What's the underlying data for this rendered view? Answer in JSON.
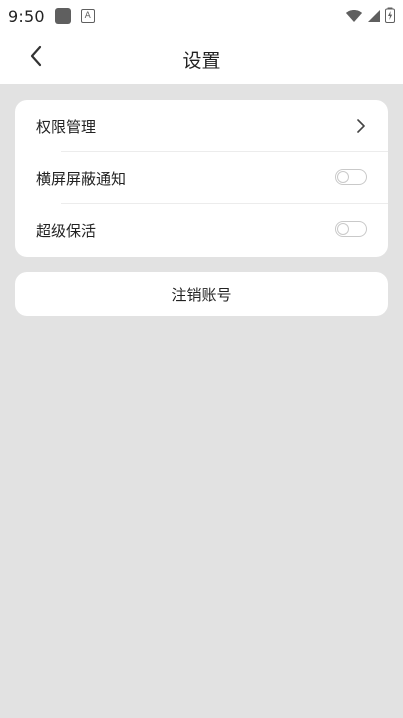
{
  "status_bar": {
    "time": "9:50",
    "icons": [
      "app-notification-icon",
      "a-icon",
      "wifi-icon",
      "signal-icon",
      "battery-icon"
    ]
  },
  "header": {
    "title": "设置",
    "back_icon": "chevron-left-icon"
  },
  "settings": {
    "items": [
      {
        "label": "权限管理",
        "control": "chevron-right-icon"
      },
      {
        "label": "横屏屏蔽通知",
        "control": "toggle",
        "on": false
      },
      {
        "label": "超级保活",
        "control": "toggle",
        "on": false
      }
    ]
  },
  "account": {
    "logout_label": "注销账号"
  },
  "colors": {
    "page_bg": "#e2e2e2",
    "card_bg": "#ffffff",
    "text": "#222222",
    "divider": "#ececec",
    "toggle_border": "#c9c9c9"
  }
}
